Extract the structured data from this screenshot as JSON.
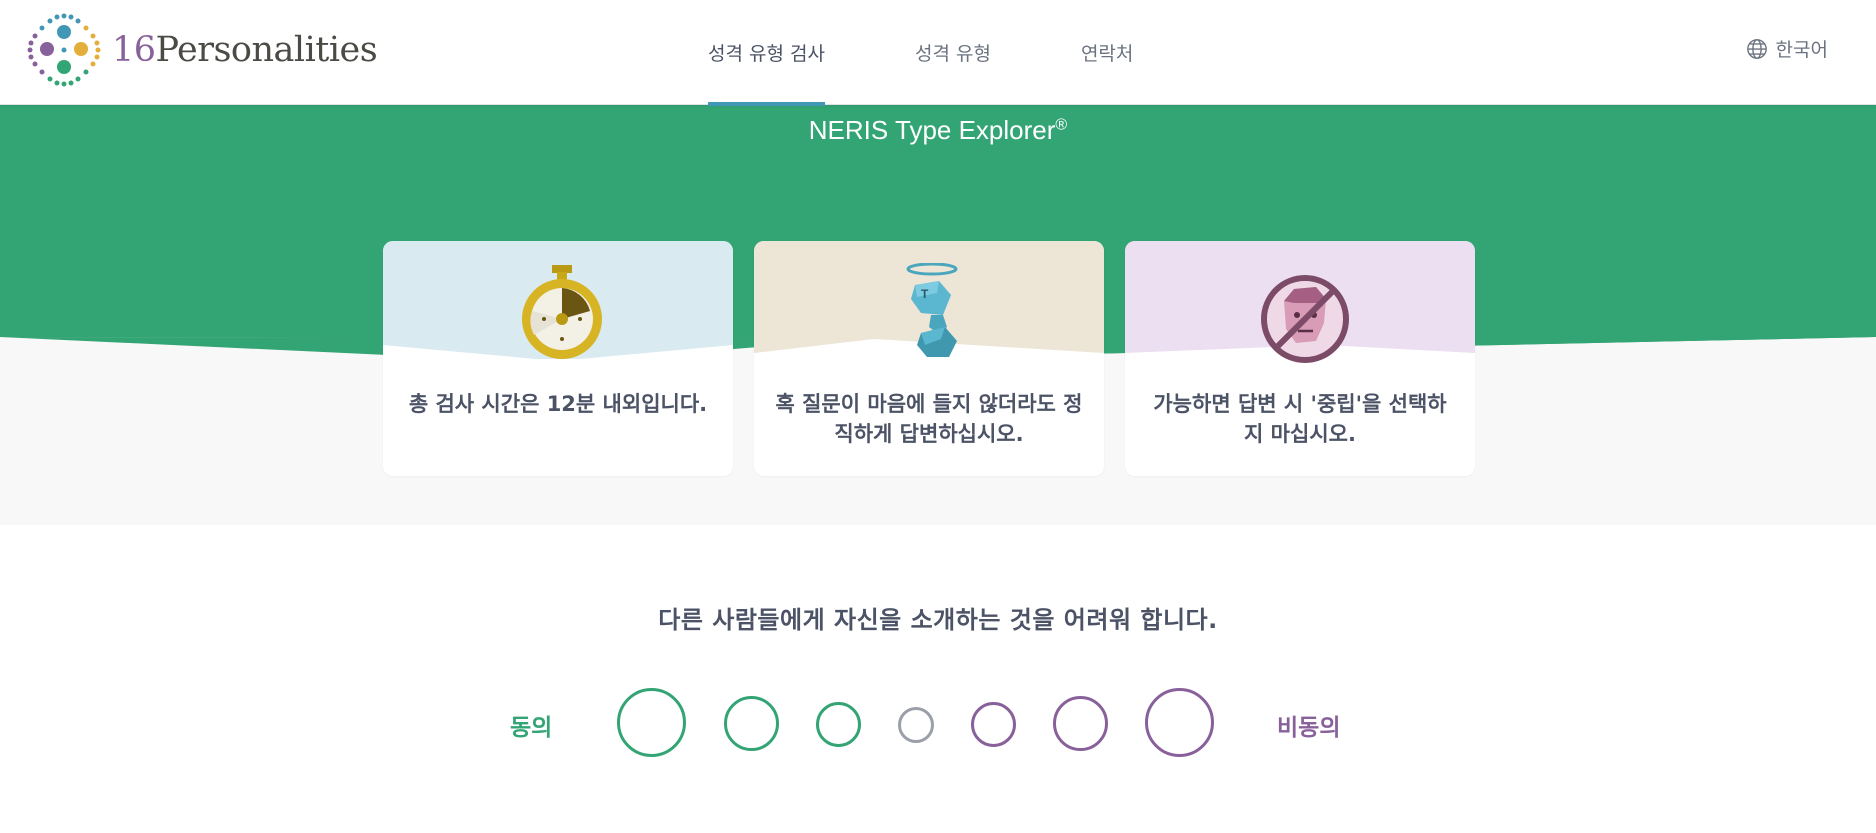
{
  "header": {
    "logo_number": "16",
    "logo_text": "Personalities",
    "nav": [
      {
        "label": "성격 유형 검사",
        "active": true
      },
      {
        "label": "성격 유형",
        "active": false
      },
      {
        "label": "연락처",
        "active": false
      }
    ],
    "language": "한국어"
  },
  "hero": {
    "title": "NERIS Type Explorer",
    "title_mark": "®",
    "colors": {
      "green": "#33a474",
      "background": "#f8f8f8"
    },
    "cards": [
      {
        "text": "총 검사 시간은 12분 내외입니다.",
        "color": "#d9eaf0",
        "icon": "stopwatch-icon"
      },
      {
        "text": "혹 질문이 마음에 들지 않더라도 정직하게 답변하십시오.",
        "color": "#ede5d6",
        "icon": "angel-figure-icon"
      },
      {
        "text": "가능하면 답변 시 '중립'을 선택하지 마십시오.",
        "color": "#ecdff2",
        "icon": "no-neutral-face-icon"
      }
    ]
  },
  "question": {
    "text": "다른 사람들에게 자신을 소개하는 것을 어려워 합니다.",
    "agree_label": "동의",
    "disagree_label": "비동의",
    "options": [
      {
        "name": "strongly-agree",
        "color": "#33a474"
      },
      {
        "name": "agree",
        "color": "#33a474"
      },
      {
        "name": "slightly-agree",
        "color": "#33a474"
      },
      {
        "name": "neutral",
        "color": "#9b9faa"
      },
      {
        "name": "slightly-disagree",
        "color": "#88619a"
      },
      {
        "name": "disagree",
        "color": "#88619a"
      },
      {
        "name": "strongly-disagree",
        "color": "#88619a"
      }
    ]
  }
}
